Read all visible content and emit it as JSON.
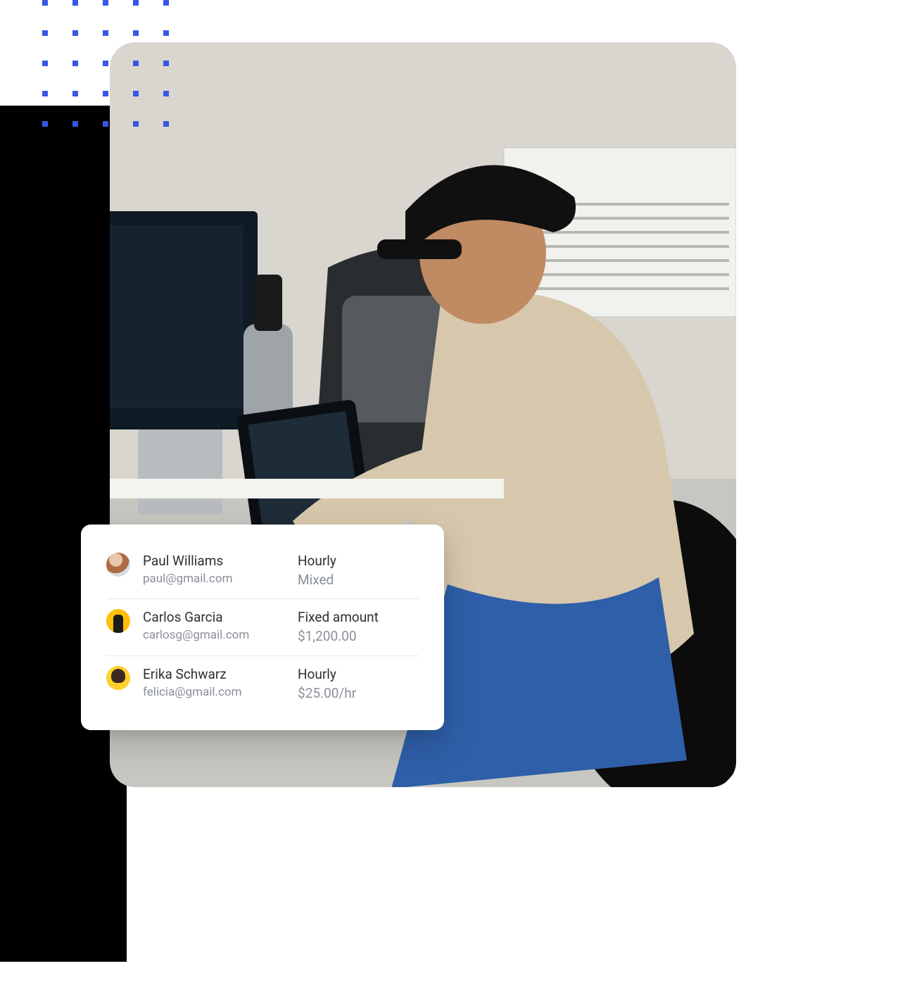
{
  "employees": [
    {
      "name": "Paul Williams",
      "email": "paul@gmail.com",
      "pay_type": "Hourly",
      "pay_value": "Mixed"
    },
    {
      "name": "Carlos Garcia",
      "email": "carlosg@gmail.com",
      "pay_type": "Fixed amount",
      "pay_value": "$1,200.00"
    },
    {
      "name": "Erika Schwarz",
      "email": "felicia@gmail.com",
      "pay_type": "Hourly",
      "pay_value": "$25.00/hr"
    }
  ]
}
